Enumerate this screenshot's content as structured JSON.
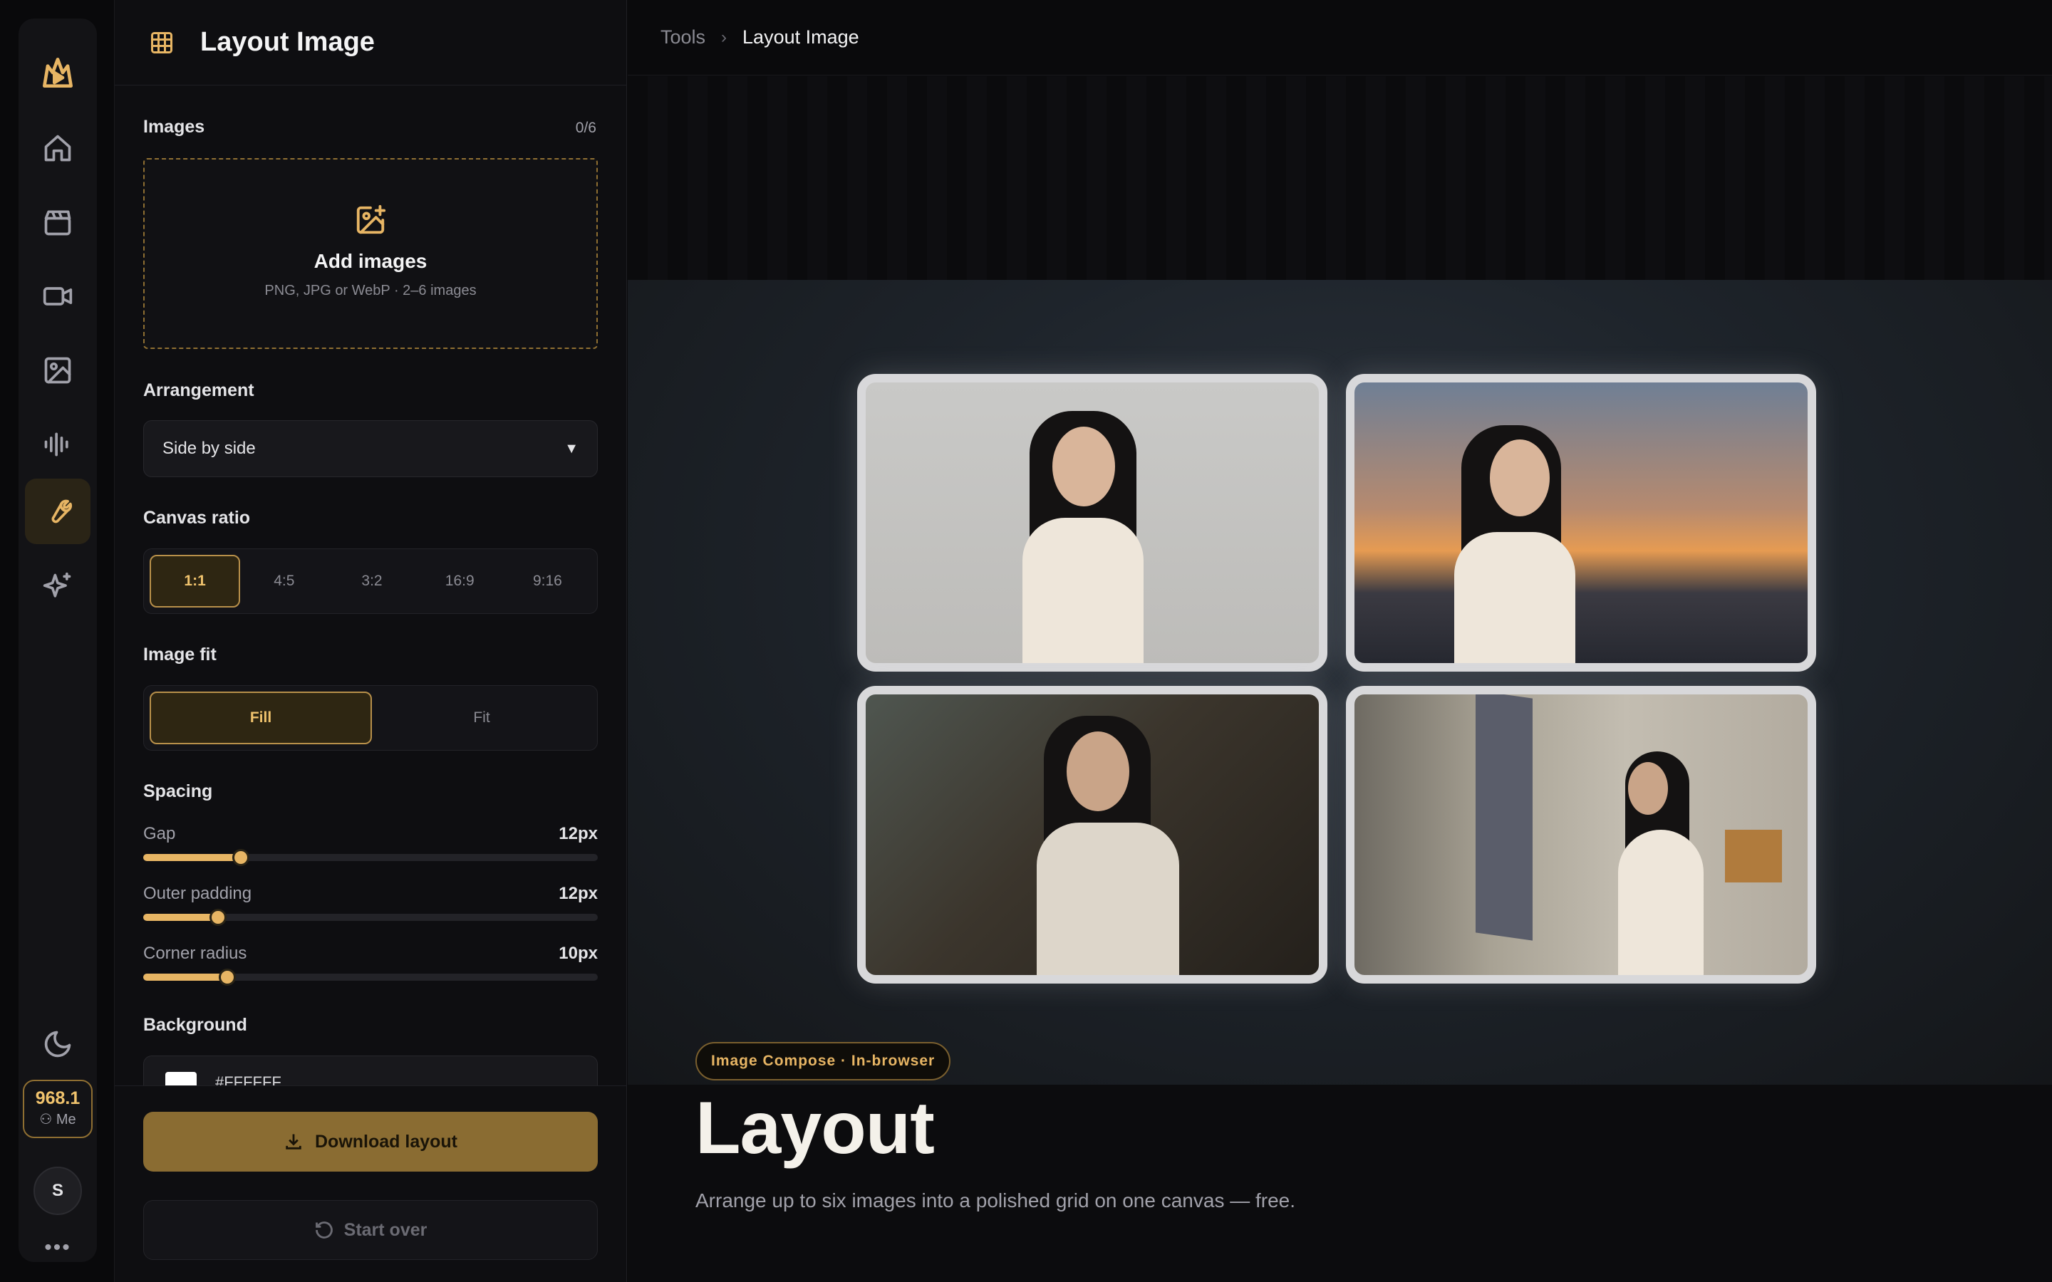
{
  "rail": {
    "items": [
      "logo-icon",
      "home-icon",
      "clapperboard-icon",
      "video-icon",
      "image-icon",
      "audio-wave-icon",
      "wrench-icon",
      "sparkles-icon"
    ],
    "active": "wrench-icon",
    "credits": "968.1",
    "credits_user": "Me",
    "avatar": "S",
    "more": "•••"
  },
  "panel": {
    "title": "Layout Image",
    "images": {
      "label": "Images",
      "count": "0/6",
      "add_title": "Add images",
      "add_hint": "PNG, JPG or WebP · 2–6 images"
    },
    "arrangement": {
      "label": "Arrangement",
      "selected": "Side by side"
    },
    "ratio": {
      "label": "Canvas ratio",
      "options": [
        "1:1",
        "4:5",
        "3:2",
        "16:9",
        "9:16"
      ],
      "selected": "1:1"
    },
    "fit": {
      "label": "Image fit",
      "options": [
        "Fill",
        "Fit"
      ],
      "selected": "Fill"
    },
    "spacing": {
      "label": "Spacing",
      "gap": {
        "label": "Gap",
        "value": "12px",
        "fraction": 0.215
      },
      "padding": {
        "label": "Outer padding",
        "value": "12px",
        "fraction": 0.165
      },
      "radius": {
        "label": "Corner radius",
        "value": "10px",
        "fraction": 0.185
      }
    },
    "background": {
      "label": "Background",
      "color": "#FFFFFF"
    },
    "download_label": "Download layout",
    "start_over_label": "Start over"
  },
  "breadcrumb": {
    "root": "Tools",
    "separator": "›",
    "current": "Layout Image"
  },
  "hero": {
    "badge": "Image Compose · In-browser",
    "title": "Layout",
    "subtitle": "Arrange up to six images into a polished grid on one canvas — free."
  },
  "colors": {
    "accent": "#e7b564",
    "panel": "#0e0e11",
    "rail": "#131316"
  }
}
